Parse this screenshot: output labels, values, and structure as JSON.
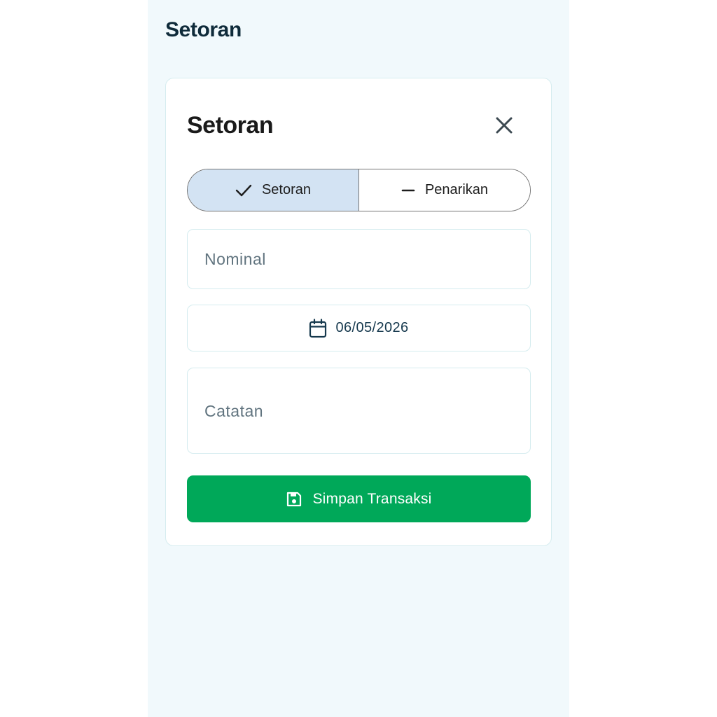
{
  "page": {
    "title": "Setoran"
  },
  "dialog": {
    "title": "Setoran",
    "close_icon": "close-icon",
    "type_toggle": {
      "selected": "Setoran",
      "options": [
        {
          "label": "Setoran",
          "icon": "check-icon",
          "active": true
        },
        {
          "label": "Penarikan",
          "icon": "minus-icon",
          "active": false
        }
      ]
    },
    "nominal": {
      "placeholder": "Nominal",
      "value": ""
    },
    "date": {
      "value": "06/05/2026",
      "icon": "calendar-icon"
    },
    "note": {
      "placeholder": "Catatan",
      "value": ""
    },
    "save_button": {
      "label": "Simpan Transaksi",
      "icon": "save-icon"
    }
  },
  "colors": {
    "background": "#f1f9fc",
    "active_segment": "#d3e3f3",
    "save_button": "#00a859",
    "field_border": "#d5ecef"
  }
}
